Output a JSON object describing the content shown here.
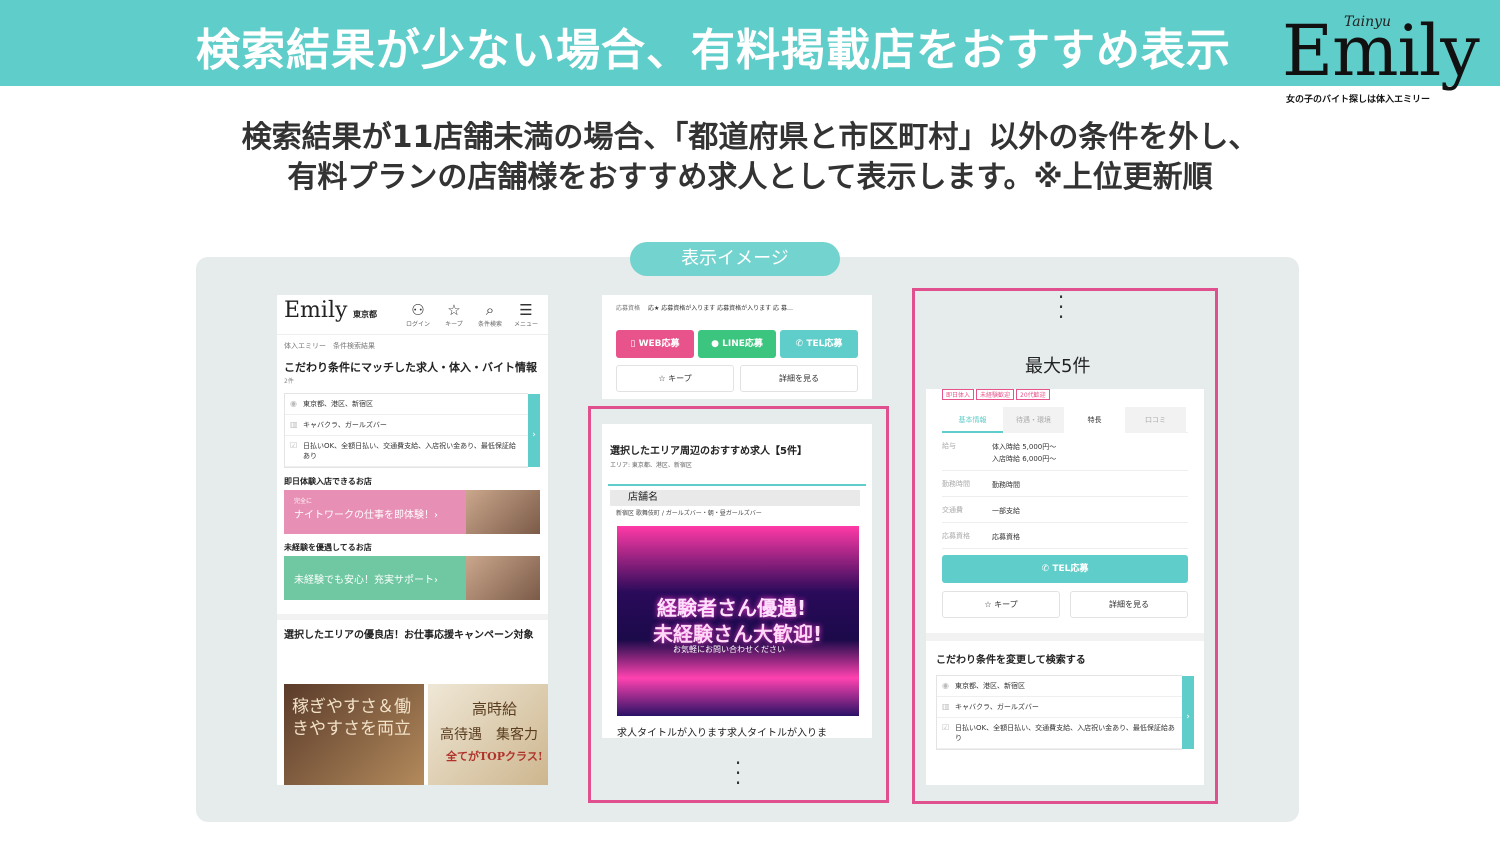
{
  "banner": {
    "title": "検索結果が少ない場合、有料掲載店をおすすめ表示",
    "logo_script": "Tainyu",
    "logo_word": "Emily",
    "logo_tagline": "女の子のバイト探しは体入エミリー"
  },
  "description": {
    "line1": "検索結果が11店舗未満の場合、「都道府県と市区町村」以外の条件を外し、",
    "line2": "有料プランの店舗様をおすすめ求人として表示します。※上位更新順"
  },
  "display_label": "表示イメージ",
  "max_label": "最大5件",
  "screen1": {
    "logo": "Emily",
    "area": "東京都",
    "nav": [
      {
        "icon": "user-icon",
        "glyph": "⚇",
        "label": "ログイン"
      },
      {
        "icon": "star-icon",
        "glyph": "☆",
        "label": "キープ"
      },
      {
        "icon": "search-icon",
        "glyph": "⌕",
        "label": "条件検索"
      },
      {
        "icon": "menu-icon",
        "glyph": "☰",
        "label": "メニュー"
      }
    ],
    "breadcrumb": "体入エミリー　条件検索結果",
    "heading": "こだわり条件にマッチした求人・体入・バイト情報",
    "count": "2件",
    "conditions": [
      "東京都、港区、新宿区",
      "キャバクラ、ガールズバー",
      "日払いOK、全額日払い、交通費支給、入店祝い金あり、最低保証給あり"
    ],
    "section1": "即日体験入店できるお店",
    "promo1_small": "完全に",
    "promo1": "ナイトワークの仕事を即体験！›",
    "section2": "未経験を優遇してるお店",
    "promo2": "未経験でも安心！充実サポート›",
    "campaign": "選択したエリアの優良店！お仕事応援キャンペーン対象",
    "bannerA": "稼ぎやすさ＆働きやすさを両立",
    "bannerB_1": "高時給",
    "bannerB_2": "高待遇　集客力",
    "bannerB_3": "全てがTOPクラス!"
  },
  "screen2": {
    "qual_label": "応募資格",
    "qual_text": "応★ 応募資格が入ります 応募資格が入ります 応 募…",
    "web": "WEB応募",
    "line": "LINE応募",
    "tel": "TEL応募",
    "keep": "☆ キープ",
    "detail": "詳細を見る",
    "heading": "選択したエリア周辺のおすすめ求人【5件】",
    "area": "エリア: 東京都、港区、新宿区",
    "shop_name": "店舗名",
    "category": "新宿区 歌舞伎町 / ガールズバー・朝・昼ガールズバー",
    "img_line1": "経験者さん優遇!",
    "img_line2": "未経験さん大歓迎!",
    "img_line3": "お気軽にお問い合わせください",
    "job_title": "求人タイトルが入ります求人タイトルが入りま"
  },
  "screen3": {
    "tags": [
      "即日体入",
      "未経験歓迎",
      "20代歓迎"
    ],
    "tabs": [
      "基本情報",
      "待遇・環境",
      "特長",
      "口コミ"
    ],
    "info": [
      {
        "k": "給与",
        "v1": "体入時給 5,000円〜",
        "v2": "入店時給 6,000円〜"
      },
      {
        "k": "勤務時間",
        "v1": "勤務時間",
        "v2": ""
      },
      {
        "k": "交通費",
        "v1": "一部支給",
        "v2": ""
      },
      {
        "k": "応募資格",
        "v1": "応募資格",
        "v2": ""
      }
    ],
    "tel": "TEL応募",
    "keep": "☆ キープ",
    "detail": "詳細を見る",
    "change_heading": "こだわり条件を変更して検索する",
    "conditions": [
      "東京都、港区、新宿区",
      "キャバクラ、ガールズバー",
      "日払いOK、全額日払い、交通費支給、入店祝い金あり、最低保証給あり"
    ]
  }
}
